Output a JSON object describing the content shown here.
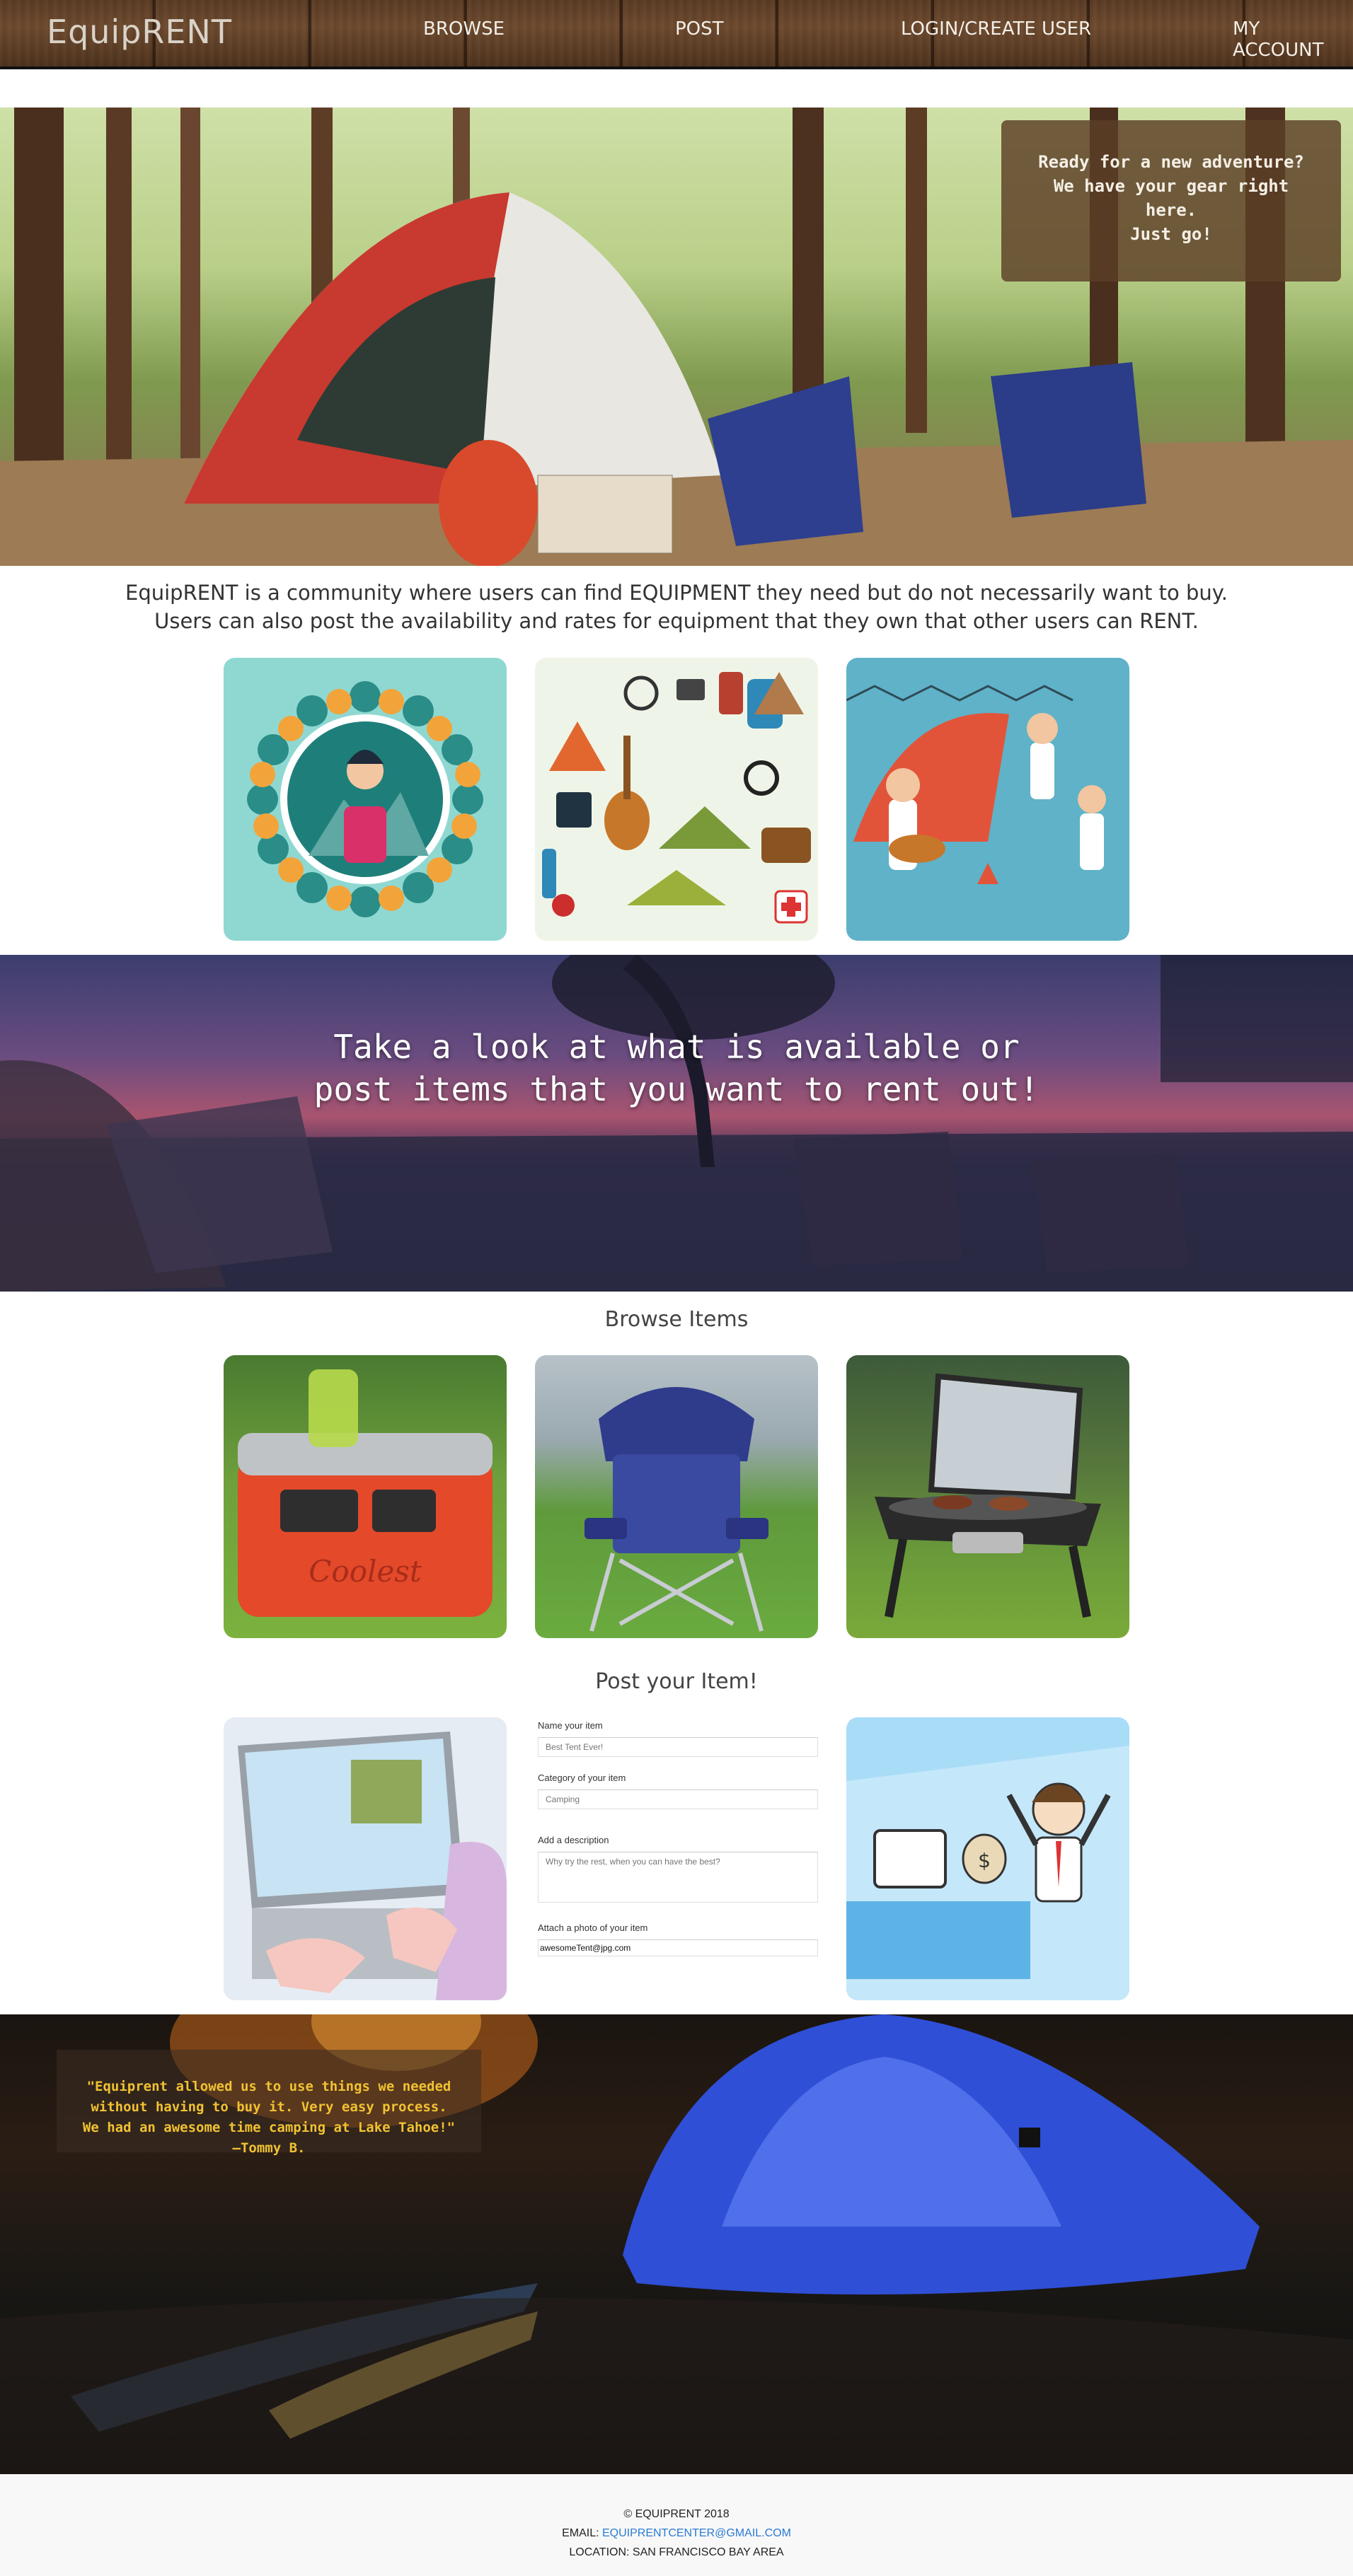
{
  "nav": {
    "brand": "EquipRENT",
    "links": [
      "BROWSE",
      "POST",
      "LOGIN/CREATE USER",
      "MY ACCOUNT"
    ]
  },
  "hero": {
    "tagline": "Ready for a new adventure?\nWe have your gear right\nhere.\nJust go!"
  },
  "intro": {
    "line1": "EquipRENT is a community where users can find EQUIPMENT they need but do not necessarily want to buy.",
    "line2": "Users can also post the availability and rates for equipment that they own that other users can RENT."
  },
  "banner": {
    "text": "Take a look at what is available or\npost items that you want to rent out!"
  },
  "browse": {
    "title": "Browse Items"
  },
  "post": {
    "title": "Post your Item!",
    "form": {
      "name_label": "Name your item",
      "name_placeholder": "Best Tent Ever!",
      "category_label": "Category of your item",
      "category_placeholder": "Camping",
      "description_label": "Add a description",
      "description_placeholder": "Why try the rest, when you can have the best?",
      "photo_label": "Attach a photo of your item",
      "photo_value": "awesomeTent@jpg.com"
    }
  },
  "testimonial": {
    "quote": "\"Equiprent allowed us to use things we needed\nwithout having to buy it. Very easy process.\nWe had an awesome time camping at Lake Tahoe!\"\n—Tommy B."
  },
  "footer": {
    "copyright": "© EQUIPRENT 2018",
    "email_label": "EMAIL: ",
    "email": "EQUIPRENTCENTER@GMAIL.COM",
    "location": "LOCATION: SAN FRANCISCO BAY AREA"
  },
  "colors": {
    "nav_wood": "#5b3b24",
    "hero_box": "#5c3e26",
    "testimonial_text": "#f1c232",
    "link": "#2a7bd4"
  }
}
